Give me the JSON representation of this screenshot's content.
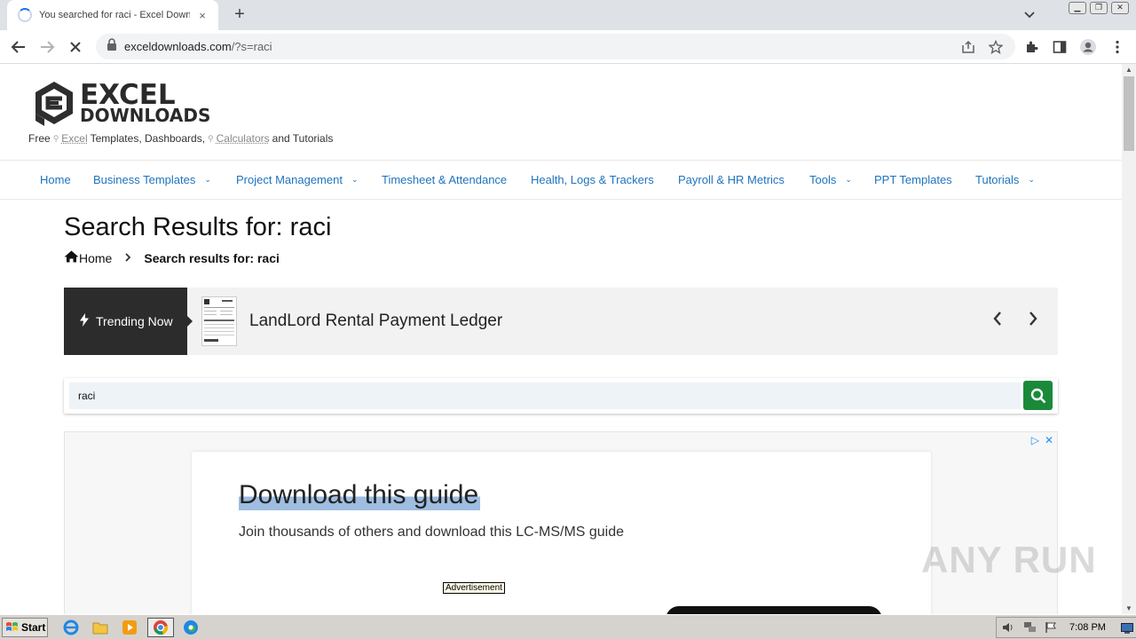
{
  "browser": {
    "tab_title": "You searched for raci - Excel Downlo",
    "tab_close": "×",
    "new_tab": "+",
    "url_host": "exceldownloads.com",
    "url_path": "/?s=raci"
  },
  "site": {
    "logo_line1": "EXCEL",
    "logo_line2": "DOWNLOADS",
    "tagline": {
      "free": "Free",
      "excel": "Excel",
      "mid": "Templates, Dashboards,",
      "calculators": "Calculators",
      "end": "and Tutorials"
    },
    "nav": [
      {
        "label": "Home"
      },
      {
        "label": "Business Templates"
      },
      {
        "label": "Project Management"
      },
      {
        "label": "Timesheet & Attendance"
      },
      {
        "label": "Health, Logs & Trackers"
      },
      {
        "label": "Payroll & HR Metrics"
      },
      {
        "label": "Tools"
      },
      {
        "label": "PPT Templates"
      },
      {
        "label": "Tutorials"
      }
    ]
  },
  "page": {
    "title": "Search Results for: raci",
    "breadcrumb_home": "Home",
    "breadcrumb_current": "Search results for: raci"
  },
  "trending": {
    "label": "Trending Now",
    "headline": "LandLord Rental Payment Ledger"
  },
  "search": {
    "value": "raci"
  },
  "ad": {
    "headline": "Download this guide",
    "subtext": "Join thousands of others and download this LC-MS/MS guide",
    "label": "Advertisement"
  },
  "watermark": "ANY RUN",
  "taskbar": {
    "start_label": "Start",
    "clock": "7:08 PM"
  }
}
